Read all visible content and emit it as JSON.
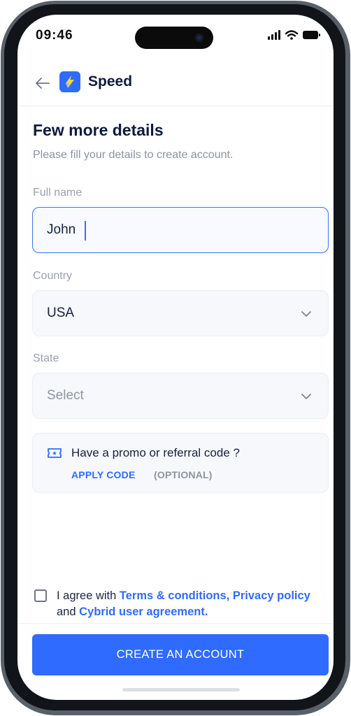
{
  "status_bar": {
    "time": "09:46"
  },
  "header": {
    "brand": "Speed"
  },
  "form": {
    "title": "Few more details",
    "subtitle": "Please fill your details to create account.",
    "full_name": {
      "label": "Full name",
      "value": "John"
    },
    "country": {
      "label": "Country",
      "value": "USA"
    },
    "state": {
      "label": "State",
      "placeholder": "Select"
    }
  },
  "promo": {
    "text": "Have a promo or referral code ?",
    "apply_label": "APPLY CODE",
    "optional_label": "(OPTIONAL)"
  },
  "agreement": {
    "prefix": "I agree with ",
    "terms_link": "Terms & conditions,",
    "privacy_link": "Privacy policy",
    "middle": " and ",
    "cybrid_link": "Cybrid user agreement."
  },
  "cta": {
    "label": "CREATE AN ACCOUNT"
  },
  "colors": {
    "accent": "#2f6bff",
    "title": "#0f1b3d",
    "muted": "#8a93a3"
  }
}
